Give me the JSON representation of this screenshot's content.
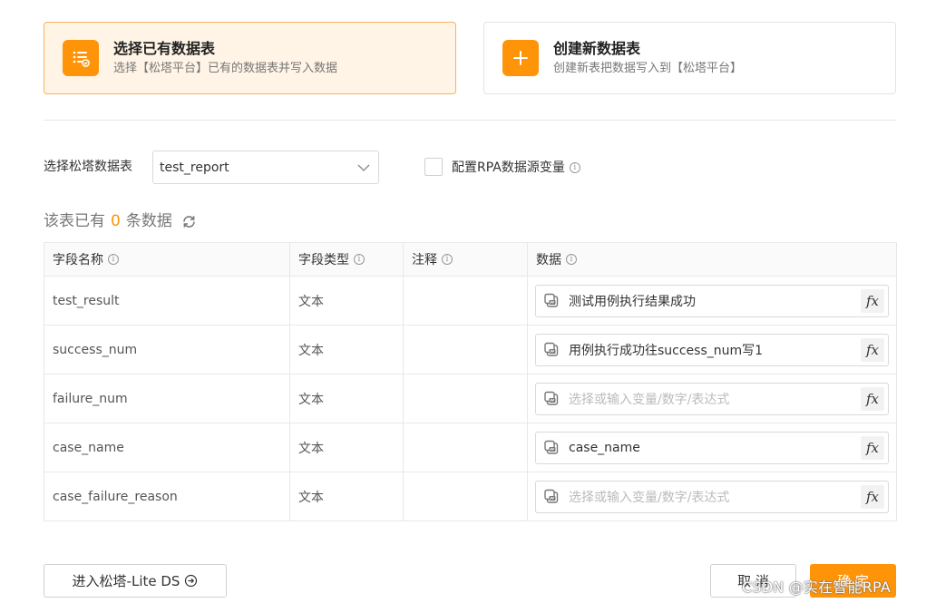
{
  "cards": [
    {
      "title": "选择已有数据表",
      "desc": "选择【松塔平台】已有的数据表并写入数据",
      "icon": "table-list-icon",
      "selected": true
    },
    {
      "title": "创建新数据表",
      "desc": "创建新表把数据写入到【松塔平台】",
      "icon": "plus-icon",
      "selected": false
    }
  ],
  "form": {
    "table_label": "选择松塔数据表",
    "table_value": "test_report",
    "rpa_label": "配置RPA数据源变量",
    "rpa_checked": false
  },
  "count": {
    "prefix": "该表已有",
    "value": "0",
    "suffix": "条数据"
  },
  "table": {
    "headers": [
      "字段名称",
      "字段类型",
      "注释",
      "数据"
    ],
    "rows": [
      {
        "name": "test_result",
        "type": "文本",
        "note": "",
        "data": "测试用例执行结果成功",
        "placeholder": false
      },
      {
        "name": "success_num",
        "type": "文本",
        "note": "",
        "data": "用例执行成功往success_num写1",
        "placeholder": false
      },
      {
        "name": "failure_num",
        "type": "文本",
        "note": "",
        "data": "选择或输入变量/数字/表达式",
        "placeholder": true
      },
      {
        "name": "case_name",
        "type": "文本",
        "note": "",
        "data": "case_name",
        "placeholder": false
      },
      {
        "name": "case_failure_reason",
        "type": "文本",
        "note": "",
        "data": "选择或输入变量/数字/表达式",
        "placeholder": true
      }
    ],
    "fx_label": "fx"
  },
  "buttons": {
    "lite": "进入松塔-Lite DS",
    "cancel": "取 消",
    "ok": "确 定"
  },
  "watermark": "CSDN @实在智能RPA",
  "colors": {
    "accent": "#ff9408",
    "selected_bg": "#fff4e6",
    "border": "#e8e8e8"
  }
}
